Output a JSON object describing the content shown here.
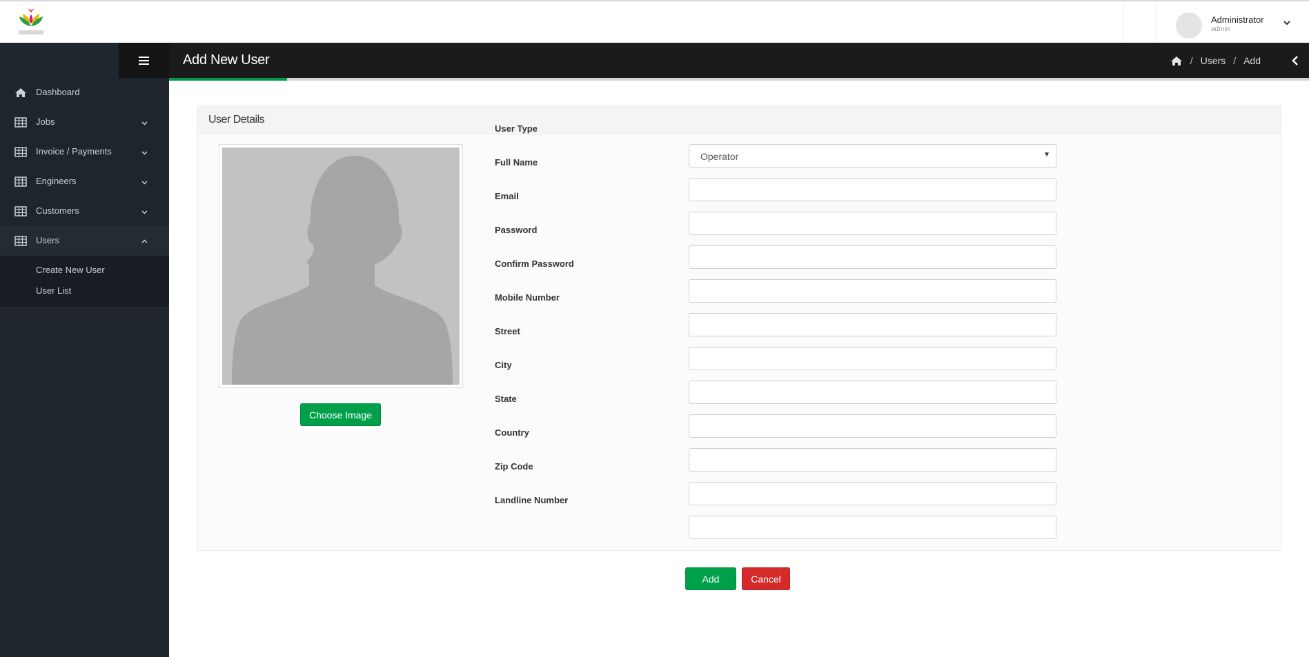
{
  "topbar": {
    "user_name": "Administrator",
    "user_role": "admin"
  },
  "sidebar": {
    "items": [
      {
        "label": "Dashboard",
        "icon": "home-icon"
      },
      {
        "label": "Jobs",
        "icon": "table-icon"
      },
      {
        "label": "Invoice / Payments",
        "icon": "table-icon"
      },
      {
        "label": "Engineers",
        "icon": "table-icon"
      },
      {
        "label": "Customers",
        "icon": "table-icon"
      },
      {
        "label": "Users",
        "icon": "table-icon"
      }
    ],
    "submenu": [
      "Create New User",
      "User List"
    ]
  },
  "header": {
    "title": "Add New User",
    "breadcrumb": [
      "Users",
      "Add"
    ]
  },
  "panel": {
    "title": "User Details",
    "choose_image_label": "Choose Image"
  },
  "form": {
    "user_type_label": "User Type",
    "user_type_value": "Operator",
    "fields": [
      {
        "label": "Full Name",
        "value": ""
      },
      {
        "label": "Email",
        "value": ""
      },
      {
        "label": "Password",
        "value": ""
      },
      {
        "label": "Confirm Password",
        "value": ""
      },
      {
        "label": "Mobile Number",
        "value": ""
      },
      {
        "label": "Street",
        "value": ""
      },
      {
        "label": "City",
        "value": ""
      },
      {
        "label": "State",
        "value": ""
      },
      {
        "label": "Country",
        "value": ""
      },
      {
        "label": "Zip Code",
        "value": ""
      },
      {
        "label": "Landline Number",
        "value": ""
      }
    ]
  },
  "actions": {
    "add_label": "Add",
    "cancel_label": "Cancel"
  },
  "colors": {
    "accent_green": "#00a04a",
    "danger_red": "#d42a2a",
    "sidebar_bg": "#1f252d",
    "header_bg": "#1b1b1b"
  }
}
